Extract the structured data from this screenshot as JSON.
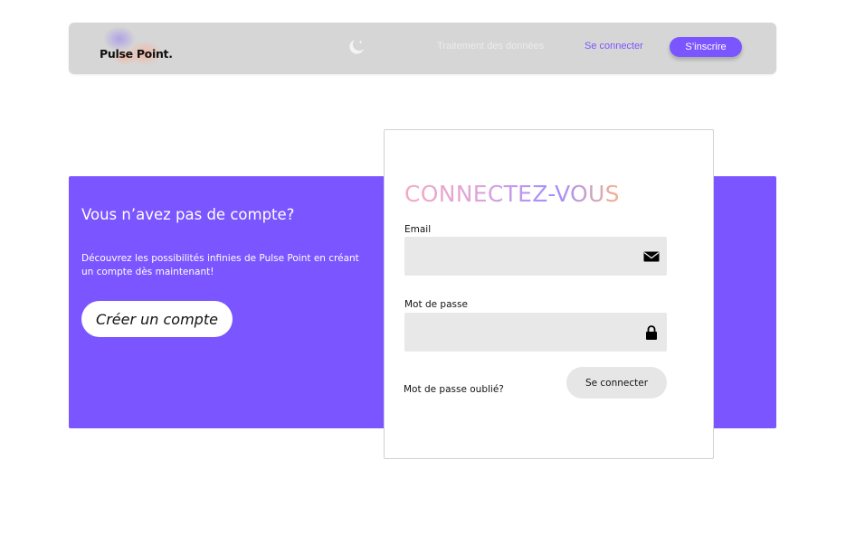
{
  "brand": {
    "name": "Pulse Point.",
    "logo_icon": "pulse-point-logo"
  },
  "nav": {
    "theme_icon": "moon-icon",
    "data_link": "Traitement des données",
    "login_link": "Se connecter",
    "signup_button": "S’inscrire"
  },
  "promo": {
    "title": "Vous n’avez pas de compte?",
    "description": "Découvrez les possibilités infinies de Pulse Point en créant un compte dès maintenant!",
    "create_button": "Créer un compte"
  },
  "login": {
    "title": "CONNECTEZ-VOUS",
    "email_label": "Email",
    "email_value": "",
    "email_icon": "envelope-icon",
    "password_label": "Mot de passe",
    "password_value": "",
    "password_icon": "lock-icon",
    "forgot_link": "Mot de passe oublié?",
    "submit_button": "Se connecter"
  },
  "colors": {
    "accent": "#7b55ff",
    "nav_bg": "#d6d6d6",
    "field_bg": "#e8e8e8",
    "button_bg": "#e6e6e6"
  }
}
